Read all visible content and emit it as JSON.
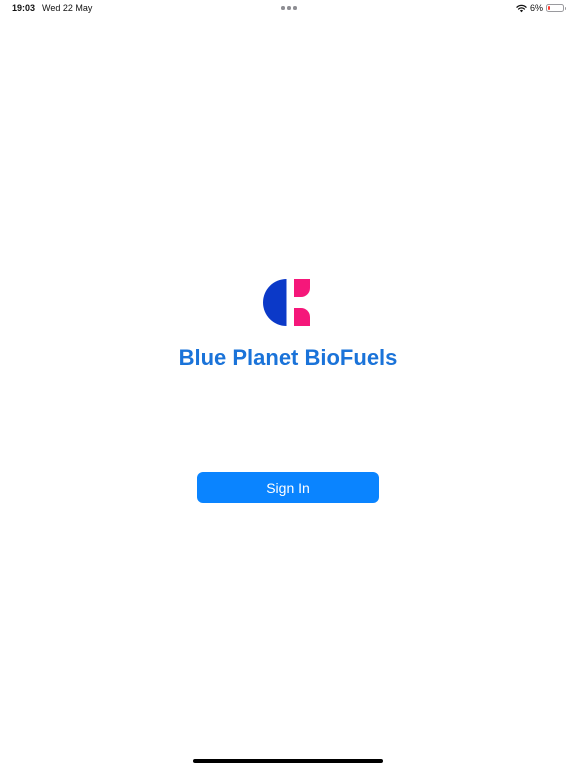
{
  "status_bar": {
    "time": "19:03",
    "date": "Wed 22 May",
    "battery_percent": "6%",
    "battery_level": 0.06,
    "icons": [
      "multitasking-dots-icon",
      "wifi-icon",
      "battery-icon"
    ]
  },
  "app": {
    "name": "Blue Planet BioFuels",
    "logo": "blue-planet-logo-icon"
  },
  "actions": {
    "sign_in_label": "Sign In"
  },
  "colors": {
    "title": "#1a73d9",
    "button": "#0a84ff",
    "logo_blue": "#0b39c8",
    "logo_pink": "#f5177a",
    "battery_low": "#ff3b30"
  }
}
